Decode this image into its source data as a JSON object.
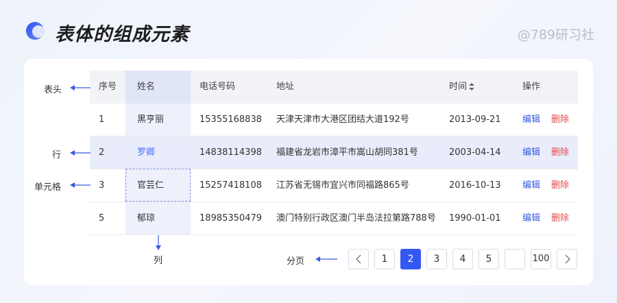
{
  "title": "表体的组成元素",
  "watermark": "@789研习社",
  "colors": {
    "accent": "#3558f2",
    "link": "#3b5bdb",
    "danger": "#e5484d",
    "selected_row": "#e9edfb",
    "column_highlight": "#eef1fc"
  },
  "annotations": {
    "header": "表头",
    "row": "行",
    "cell": "单元格",
    "column": "列",
    "pagination": "分页"
  },
  "table": {
    "headers": [
      "序号",
      "姓名",
      "电话号码",
      "地址",
      "时间",
      "操作"
    ],
    "rows": [
      {
        "index": "1",
        "name": "黑亨丽",
        "phone": "15355168838",
        "address": "天津天津市大港区团结大道192号",
        "date": "2013-09-21",
        "edit": "编辑",
        "delete": "删除"
      },
      {
        "index": "2",
        "name": "罗卿",
        "phone": "14838114398",
        "address": "福建省龙岩市漳平市嵩山胡同381号",
        "date": "2003-04-14",
        "edit": "编辑",
        "delete": "删除"
      },
      {
        "index": "3",
        "name": "官芸仁",
        "phone": "15257418108",
        "address": "江苏省无锡市宜兴市同福路865号",
        "date": "2016-10-13",
        "edit": "编辑",
        "delete": "删除"
      },
      {
        "index": "5",
        "name": "郁琼",
        "phone": "18985350479",
        "address": "澳门特别行政区澳门半岛法拉第路788号",
        "date": "1990-01-01",
        "edit": "编辑",
        "delete": "删除"
      }
    ]
  },
  "pagination": {
    "pages": [
      "1",
      "2",
      "3",
      "4",
      "5",
      "",
      "100"
    ],
    "current": "2"
  }
}
